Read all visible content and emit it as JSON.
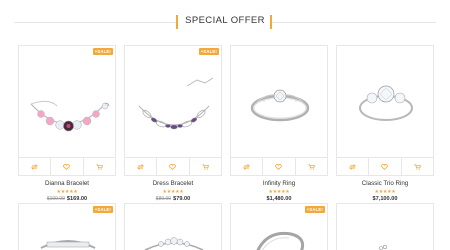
{
  "section": {
    "title": "SPECIAL OFFER"
  },
  "products": [
    {
      "name": "Dianna Bracelet",
      "rating": "★★★★★",
      "old_price": "$199.00",
      "price": "$169.00",
      "badge": "+SALE!"
    },
    {
      "name": "Dress Bracelet",
      "rating": "★★★★★",
      "old_price": "$89.00",
      "price": "$79.00",
      "badge": "+SALE!"
    },
    {
      "name": "Infinity Ring",
      "rating": "★★★★★",
      "price": "$1,480.00"
    },
    {
      "name": "Classic Trio Ring",
      "rating": "★★★★★",
      "price": "$7,100.00"
    }
  ],
  "row2": [
    {
      "badge": "+SALE!"
    },
    {
      "badge": ""
    },
    {
      "badge": "+SALE!"
    },
    {
      "badge": ""
    }
  ],
  "icons": {
    "compare": "compare-icon",
    "wishlist": "heart-icon",
    "cart": "cart-icon"
  },
  "colors": {
    "accent": "#f0a93a",
    "border": "#e7e7e7",
    "text": "#333333"
  }
}
